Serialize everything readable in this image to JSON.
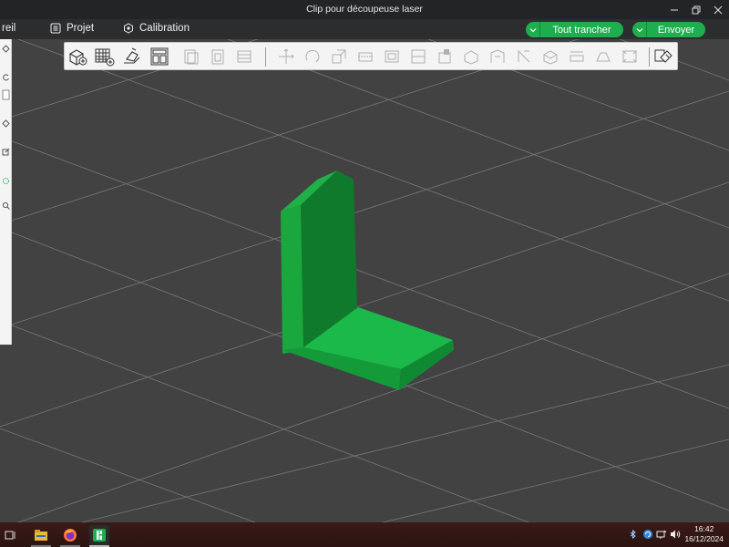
{
  "window": {
    "title": "Clip pour découpeuse laser"
  },
  "menu": {
    "items": [
      {
        "label": "reil",
        "icon": "printer-icon"
      },
      {
        "label": "Projet",
        "icon": "list-icon"
      },
      {
        "label": "Calibration",
        "icon": "calibration-icon"
      }
    ],
    "slice_label": "Tout trancher",
    "send_label": "Envoyer"
  },
  "toolbar": {
    "tools": [
      "add-object-icon",
      "plate-grid-icon",
      "auto-orient-icon",
      "arrange-icon",
      "copy-icon",
      "paste-icon",
      "layout-icon",
      "move-icon",
      "rotate-icon",
      "scale-icon",
      "cut-icon",
      "support-paint-icon",
      "seam-icon",
      "fuzzy-skin-icon",
      "measure-icon",
      "assembly-icon",
      "text-icon",
      "mesh-boolean-icon",
      "brim-ears-icon",
      "variable-layer-icon",
      "split-objects-icon",
      "view-settings-icon"
    ]
  },
  "left_panel": {
    "icons": [
      "layer-icon",
      "refresh-icon",
      "panel-icon",
      "diamond-icon",
      "edit-icon",
      "support-icon",
      "search-icon"
    ]
  },
  "colors": {
    "model_green": "#1aa83e",
    "accent_green": "#1fae4f",
    "viewport_bg": "#424242"
  },
  "taskbar": {
    "apps": [
      "taskview-icon",
      "file-manager-icon",
      "firefox-icon",
      "slicer-app-icon"
    ],
    "tray": [
      "bluetooth-icon",
      "update-icon",
      "network-icon",
      "volume-icon"
    ],
    "time": "16:42",
    "date": "16/12/2024"
  }
}
